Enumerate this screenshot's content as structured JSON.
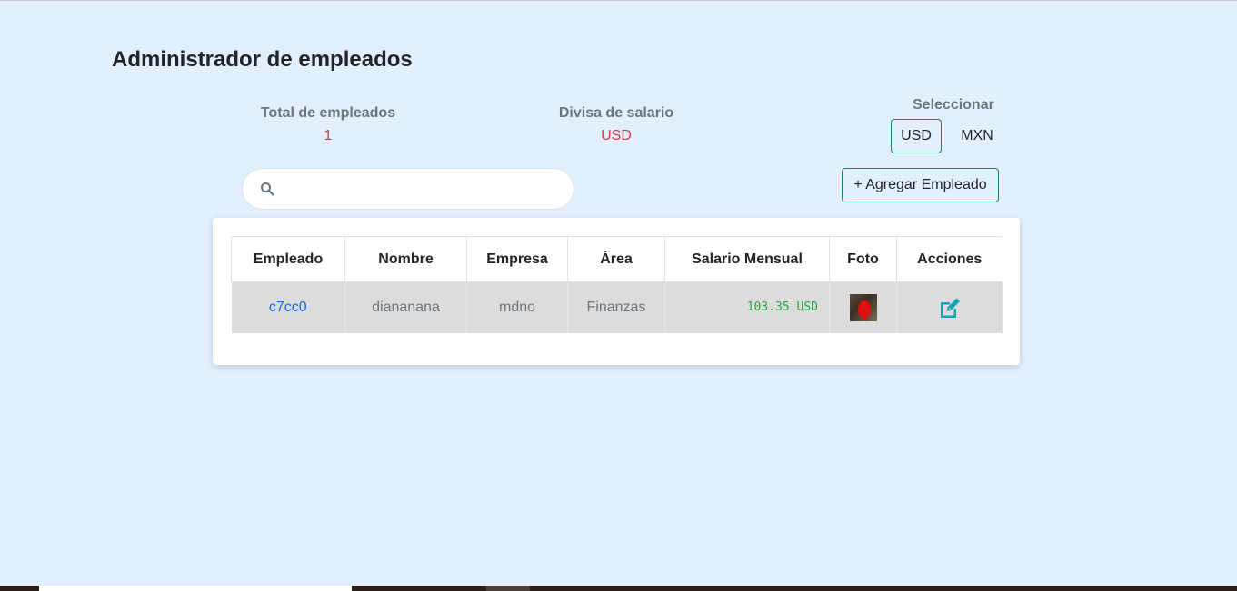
{
  "page": {
    "title": "Administrador de empleados"
  },
  "stats": {
    "total_label": "Total de empleados",
    "total_value": "1",
    "currency_label": "Divisa de salario",
    "currency_value": "USD"
  },
  "currency_selector": {
    "label": "Seleccionar",
    "options": [
      "USD",
      "MXN"
    ],
    "selected": "USD"
  },
  "search": {
    "value": "",
    "placeholder": ""
  },
  "add_button": {
    "label": "+ Agregar Empleado"
  },
  "table": {
    "headers": [
      "Empleado",
      "Nombre",
      "Empresa",
      "Área",
      "Salario Mensual",
      "Foto",
      "Acciones"
    ],
    "rows": [
      {
        "id": "c7cc0",
        "name": "diananana",
        "company": "mdno",
        "area": "Finanzas",
        "salary": "103.35 USD"
      }
    ]
  },
  "colors": {
    "background": "#e2effd",
    "accent_red": "#dc3545",
    "accent_green": "#198754",
    "link_blue": "#0d6efd",
    "salary_green": "#28a745",
    "edit_icon": "#17a2b8"
  },
  "icons": {
    "search": "search-icon",
    "edit": "edit-icon"
  }
}
